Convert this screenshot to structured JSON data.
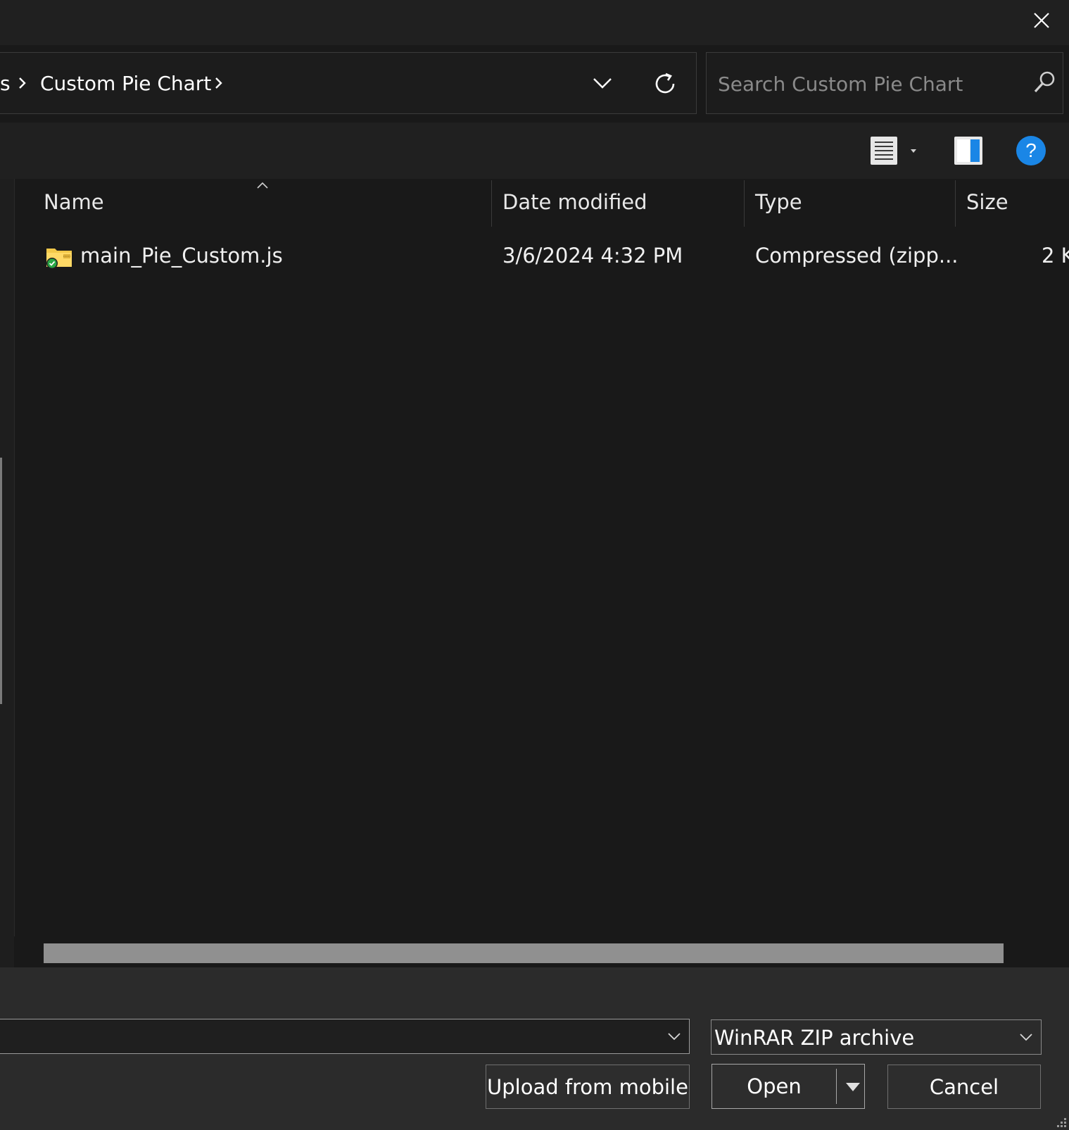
{
  "window": {
    "close_label": "✕"
  },
  "address_bar": {
    "crumb_truncated": "s",
    "crumb_current": "Custom Pie Chart"
  },
  "search": {
    "placeholder": "Search Custom Pie Chart"
  },
  "columns": {
    "name": "Name",
    "date_modified": "Date modified",
    "type": "Type",
    "size": "Size"
  },
  "files": [
    {
      "name": "main_Pie_Custom.js",
      "date_modified": "3/6/2024 4:32 PM",
      "type": "Compressed (zipp...",
      "size": "2 K"
    }
  ],
  "toolbar": {
    "help_label": "?"
  },
  "bottom": {
    "file_name_value": "",
    "file_type": "WinRAR ZIP archive",
    "upload_label": "Upload from mobile",
    "open_label": "Open",
    "cancel_label": "Cancel"
  },
  "colors": {
    "background": "#191919",
    "bottom_panel": "#2b2b2b",
    "help_blue": "#1a86e6",
    "folder_yellow": "#f3c94a"
  }
}
